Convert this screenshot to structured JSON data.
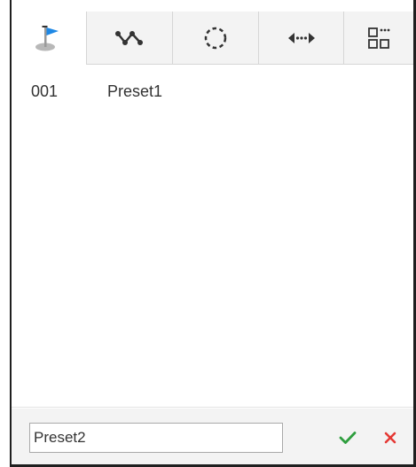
{
  "tabs": [
    {
      "id": "preset",
      "icon": "preset-flag-icon",
      "active": true
    },
    {
      "id": "tour",
      "icon": "tour-path-icon",
      "active": false
    },
    {
      "id": "pattern",
      "icon": "pattern-circle-icon",
      "active": false
    },
    {
      "id": "scan",
      "icon": "scan-arrows-icon",
      "active": false
    },
    {
      "id": "more",
      "icon": "grid-more-icon",
      "active": false
    }
  ],
  "presets": [
    {
      "number": "001",
      "name": "Preset1"
    }
  ],
  "editor": {
    "value": "Preset2",
    "placeholder": ""
  },
  "colors": {
    "flag": "#1e88e5",
    "confirm": "#2e9e3e",
    "cancel": "#e53935",
    "tab_inactive": "#f3f3f3",
    "footer": "#f3f3f3"
  }
}
